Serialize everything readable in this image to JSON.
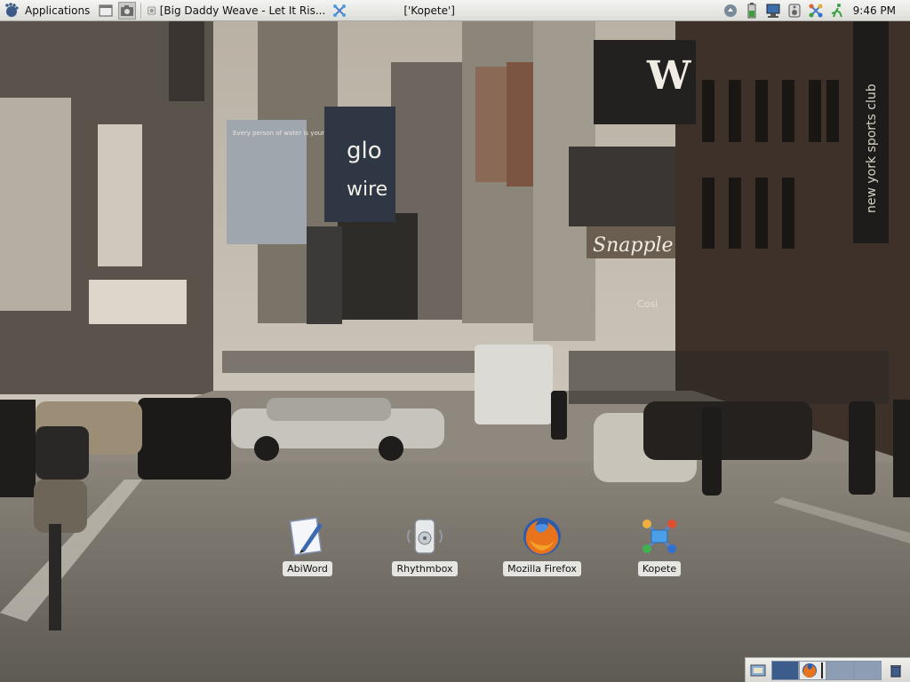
{
  "top_panel": {
    "applications_label": "Applications",
    "task_windows": [
      {
        "title": "[Big Daddy Weave - Let It Ris..."
      },
      {
        "title": "['Kopete']"
      }
    ],
    "clock": "9:46 PM"
  },
  "desktop": {
    "wallpaper_signs": {
      "glob": "glo",
      "wire": "wire",
      "water": "Every person of water is your",
      "snapple": "Snapple",
      "w": "W",
      "nysc": "new york sports club",
      "cosi": "Cosi"
    },
    "icons": [
      {
        "label": "AbiWord",
        "icon": "abiword-icon"
      },
      {
        "label": "Rhythmbox",
        "icon": "rhythmbox-icon"
      },
      {
        "label": "Mozilla Firefox",
        "icon": "firefox-icon"
      },
      {
        "label": "Kopete",
        "icon": "kopete-icon"
      }
    ]
  },
  "bottom_panel": {
    "workspaces": [
      "active",
      "firefox",
      "inactive",
      "inactive"
    ]
  }
}
